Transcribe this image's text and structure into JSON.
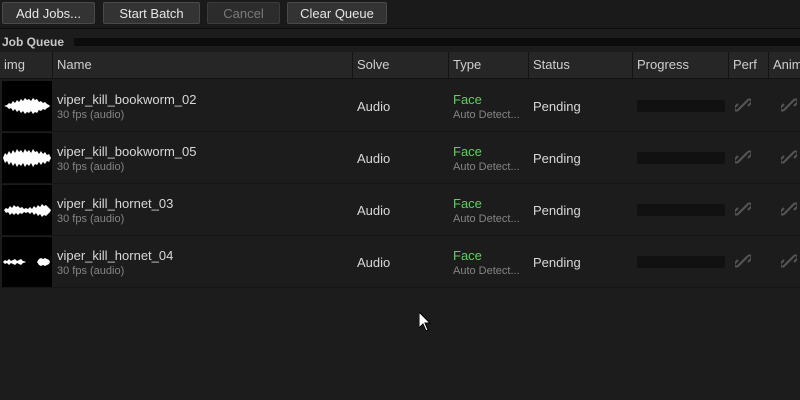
{
  "toolbar": {
    "add_jobs": "Add Jobs...",
    "start_batch": "Start Batch",
    "cancel": "Cancel",
    "clear_queue": "Clear Queue"
  },
  "queue": {
    "title": "Job Queue",
    "columns": {
      "img": "img",
      "name": "Name",
      "solve": "Solve",
      "type": "Type",
      "status": "Status",
      "progress": "Progress",
      "perf": "Perf",
      "anim": "Anim"
    },
    "rows": [
      {
        "name": "viper_kill_bookworm_02",
        "sub": "30 fps (audio)",
        "solve": "Audio",
        "type": "Face",
        "type_sub": "Auto Detect...",
        "status": "Pending",
        "progress": 0
      },
      {
        "name": "viper_kill_bookworm_05",
        "sub": "30 fps (audio)",
        "solve": "Audio",
        "type": "Face",
        "type_sub": "Auto Detect...",
        "status": "Pending",
        "progress": 0
      },
      {
        "name": "viper_kill_hornet_03",
        "sub": "30 fps (audio)",
        "solve": "Audio",
        "type": "Face",
        "type_sub": "Auto Detect...",
        "status": "Pending",
        "progress": 0
      },
      {
        "name": "viper_kill_hornet_04",
        "sub": "30 fps (audio)",
        "solve": "Audio",
        "type": "Face",
        "type_sub": "Auto Detect...",
        "status": "Pending",
        "progress": 0
      }
    ]
  },
  "colors": {
    "background": "#1c1c1c",
    "type_accent": "#5ed05e",
    "button": "#333333"
  },
  "icons": {
    "row_thumbnail": "audio-waveform-icon",
    "perf": "link-icon",
    "anim": "link-icon",
    "pointer": "mouse-cursor-icon"
  }
}
